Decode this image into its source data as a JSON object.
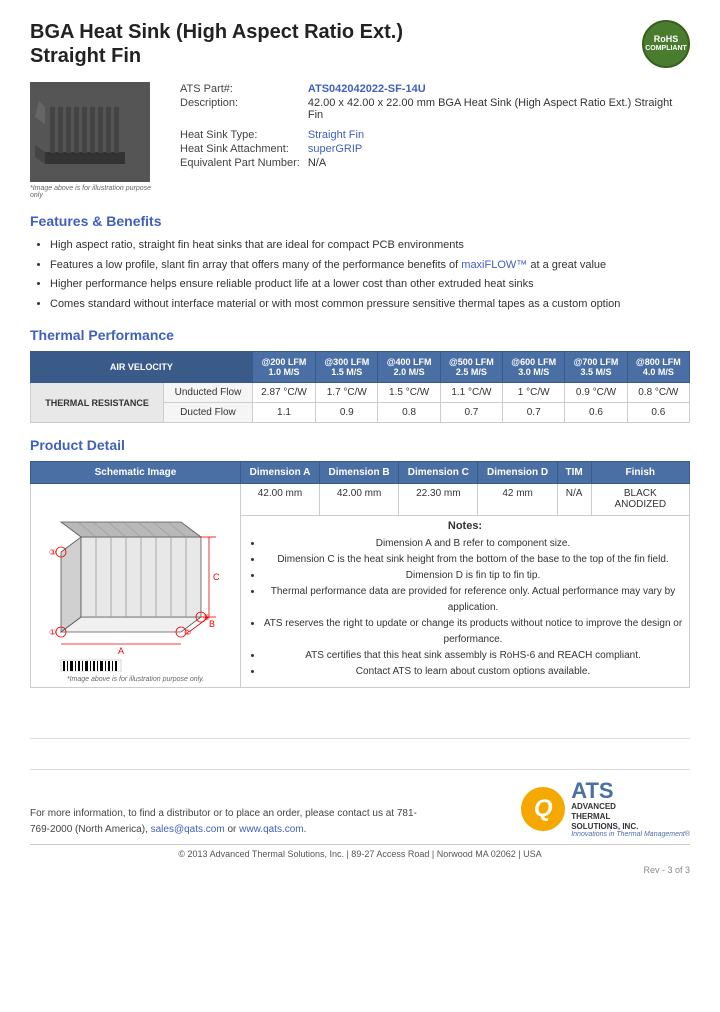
{
  "header": {
    "title_line1": "BGA Heat Sink (High Aspect Ratio Ext.)",
    "title_line2": "Straight Fin",
    "rohs_line1": "RoHS",
    "rohs_line2": "COMPLIANT"
  },
  "product": {
    "part_label": "ATS Part#:",
    "part_number": "ATS042042022-SF-14U",
    "description_label": "Description:",
    "description": "42.00 x 42.00 x 22.00 mm  BGA Heat Sink (High Aspect Ratio Ext.) Straight Fin",
    "heatsink_type_label": "Heat Sink Type:",
    "heatsink_type": "Straight Fin",
    "heatsink_attachment_label": "Heat Sink Attachment:",
    "heatsink_attachment": "superGRIP",
    "equivalent_part_label": "Equivalent Part Number:",
    "equivalent_part": "N/A",
    "image_caption": "*Image above is for illustration purpose only"
  },
  "features": {
    "heading": "Features & Benefits",
    "items": [
      "High aspect ratio, straight fin heat sinks that are ideal for compact PCB environments",
      "Features a low profile, slant fin array that offers many of the performance benefits of maxiFLOW™ at a great value",
      "Higher performance helps ensure reliable product life at a lower cost than other extruded heat sinks",
      "Comes standard without interface material or with most common pressure sensitive thermal tapes as a custom option"
    ]
  },
  "thermal": {
    "heading": "Thermal Performance",
    "col_headers": [
      {
        "lfm": "@200 LFM",
        "ms": "1.0 M/S"
      },
      {
        "lfm": "@300 LFM",
        "ms": "1.5 M/S"
      },
      {
        "lfm": "@400 LFM",
        "ms": "2.0 M/S"
      },
      {
        "lfm": "@500 LFM",
        "ms": "2.5 M/S"
      },
      {
        "lfm": "@600 LFM",
        "ms": "3.0 M/S"
      },
      {
        "lfm": "@700 LFM",
        "ms": "3.5 M/S"
      },
      {
        "lfm": "@800 LFM",
        "ms": "4.0 M/S"
      }
    ],
    "air_velocity_label": "AIR VELOCITY",
    "row_label": "THERMAL RESISTANCE",
    "rows": [
      {
        "flow": "Unducted Flow",
        "values": [
          "2.87 °C/W",
          "1.7 °C/W",
          "1.5 °C/W",
          "1.1 °C/W",
          "1 °C/W",
          "0.9 °C/W",
          "0.8 °C/W"
        ]
      },
      {
        "flow": "Ducted Flow",
        "values": [
          "1.1",
          "0.9",
          "0.8",
          "0.7",
          "0.7",
          "0.6",
          "0.6"
        ]
      }
    ]
  },
  "product_detail": {
    "heading": "Product Detail",
    "col_headers": [
      "Schematic Image",
      "Dimension A",
      "Dimension B",
      "Dimension C",
      "Dimension D",
      "TIM",
      "Finish"
    ],
    "dim_values": {
      "dim_a": "42.00 mm",
      "dim_b": "42.00 mm",
      "dim_c": "22.30 mm",
      "dim_d": "42 mm",
      "tim": "N/A",
      "finish": "BLACK ANODIZED"
    },
    "schematic_caption": "*Image above is for illustration purpose only.",
    "notes_title": "Notes:",
    "notes": [
      "Dimension A and B refer to component size.",
      "Dimension C is the heat sink height from the bottom of the base to the top of the fin field.",
      "Dimension D is fin tip to fin tip.",
      "Thermal performance data are provided for reference only. Actual performance may vary by application.",
      "ATS reserves the right to update or change its products without notice to improve the design or performance.",
      "ATS certifies that this heat sink assembly is RoHS-6 and REACH compliant.",
      "Contact ATS to learn about custom options available."
    ]
  },
  "footer": {
    "contact_text": "For more information, to find a distributor or to place an order, please contact us at 781-769-2000 (North America),",
    "email": "sales@qats.com",
    "or_text": "or",
    "website": "www.qats.com",
    "copyright": "© 2013 Advanced Thermal Solutions, Inc.  |  89-27 Access Road  |  Norwood MA  02062  |  USA",
    "page_num": "Rev - 3 of 3",
    "ats_q": "Q",
    "ats_name": "ATS",
    "ats_full1": "ADVANCED",
    "ats_full2": "THERMAL",
    "ats_full3": "SOLUTIONS, INC.",
    "ats_tagline": "Innovations in Thermal Management®"
  }
}
